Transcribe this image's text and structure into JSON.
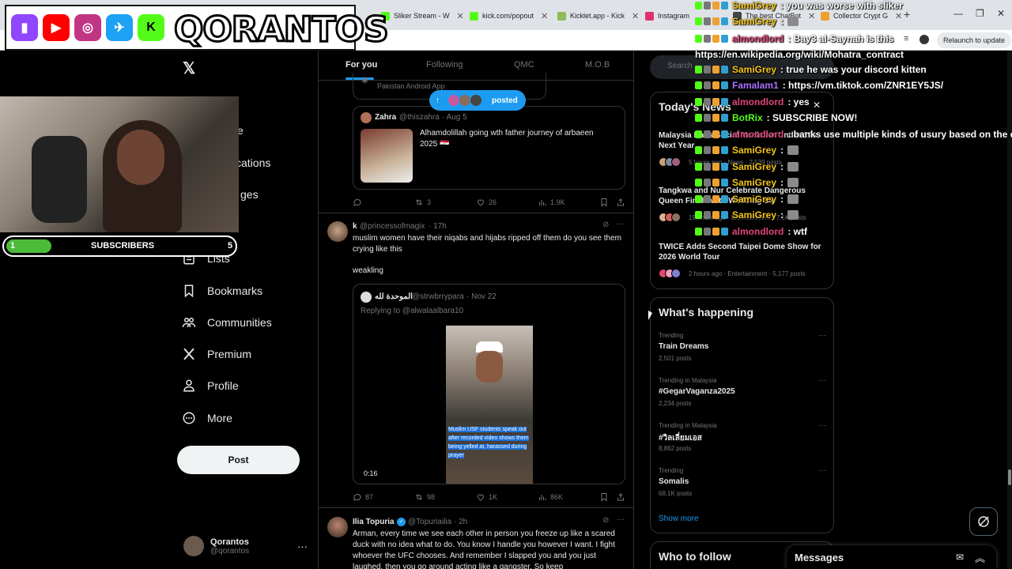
{
  "browser": {
    "tabs": [
      {
        "label": "Sliker Stream - W",
        "color": "#53fc18"
      },
      {
        "label": "kick.com/popout",
        "color": "#53fc18"
      },
      {
        "label": "Kicklet.app - Kick",
        "color": "#8fbc5a"
      },
      {
        "label": "Instagram",
        "color": "#e1306c"
      },
      {
        "label": "The best ChatBot",
        "color": "#444444"
      },
      {
        "label": "Collector Crypt G",
        "color": "#f0a030"
      }
    ],
    "new_tab": "+",
    "relaunch": "Relaunch to update"
  },
  "overlay": {
    "brand_name": "QORANTOS",
    "brand_icons": [
      {
        "name": "twitch-icon",
        "color": "#9146ff",
        "glyph": "▮"
      },
      {
        "name": "youtube-icon",
        "color": "#ff0000",
        "glyph": "▶"
      },
      {
        "name": "instagram-icon",
        "color": "#c13584",
        "glyph": "◎"
      },
      {
        "name": "twitter-bird-icon",
        "color": "#1da1f2",
        "glyph": "✈"
      },
      {
        "name": "kick-icon",
        "color": "#53fc18",
        "glyph": "K"
      }
    ],
    "subscribers": {
      "label": "SUBSCRIBERS",
      "current": "1",
      "goal": "5",
      "progress": 0.2
    }
  },
  "chat": [
    {
      "user": "SamiGrey",
      "color": "#f5c518",
      "message": ": you was worse with sliker",
      "emote": false
    },
    {
      "user": "SamiGrey",
      "color": "#f5c518",
      "message": ":",
      "emote": true
    },
    {
      "user": "almondlord",
      "color": "#e0457b",
      "message": ": Bay3 al-Saynah is this",
      "emote": false
    },
    {
      "user": "",
      "color": "#ffffff",
      "message": "https://en.wikipedia.org/wiki/Mohatra_contract",
      "emote": false
    },
    {
      "user": "SamiGrey",
      "color": "#f5c518",
      "message": ": true he was your discord kitten",
      "emote": false
    },
    {
      "user": "Famalam1",
      "color": "#a970ff",
      "message": ": https://vm.tiktok.com/ZNR1EY5JS/",
      "emote": false
    },
    {
      "user": "almondlord",
      "color": "#e0457b",
      "message": ": yes",
      "emote": false
    },
    {
      "user": "BotRix",
      "color": "#53fc18",
      "message": ": SUBSCRIBE NOW!",
      "emote": false
    },
    {
      "user": "almondlord",
      "color": "#e0457b",
      "message": ": banks use multiple kinds of usury based on the deal",
      "emote": false
    },
    {
      "user": "SamiGrey",
      "color": "#f5c518",
      "message": ":",
      "emote": true
    },
    {
      "user": "SamiGrey",
      "color": "#f5c518",
      "message": ":",
      "emote": true
    },
    {
      "user": "SamiGrey",
      "color": "#f5c518",
      "message": ":",
      "emote": true
    },
    {
      "user": "SamiGrey",
      "color": "#f5c518",
      "message": ":",
      "emote": true
    },
    {
      "user": "SamiGrey",
      "color": "#f5c518",
      "message": ":",
      "emote": true
    },
    {
      "user": "almondlord",
      "color": "#e0457b",
      "message": ": wtf",
      "emote": false
    }
  ],
  "nav": {
    "items": [
      {
        "label": "Lists",
        "icon": "list-icon"
      },
      {
        "label": "Bookmarks",
        "icon": "bookmark-icon"
      },
      {
        "label": "Communities",
        "icon": "communities-icon"
      },
      {
        "label": "Premium",
        "icon": "x-premium-icon"
      },
      {
        "label": "Profile",
        "icon": "profile-icon"
      },
      {
        "label": "More",
        "icon": "more-circle-icon"
      }
    ],
    "partial": [
      "e",
      "cations",
      "ges"
    ],
    "post_button": "Post",
    "account": {
      "name": "Qorantos",
      "handle": "@qorantos"
    }
  },
  "feed": {
    "tabs": [
      "For you",
      "Following",
      "QMC",
      "M.O.B"
    ],
    "posted_pill": "posted",
    "first_card_caption": "Pakistan Android App",
    "quote1": {
      "name": "Zahra",
      "handle": "@thiszahra",
      "date": "· Aug 5",
      "text": "Alhamdolillah going wth father journey of arbaeen 2025 🇮🇶"
    },
    "post1_stats": {
      "replies": "",
      "reposts": "3",
      "likes": "26",
      "views": "1.9K"
    },
    "post2": {
      "name": "k",
      "handle": "@princessofmagix",
      "time": "· 17h",
      "text": "muslim women have their niqabs and hijabs ripped off them do you see them crying like this",
      "text2": "weakling"
    },
    "quote2": {
      "name": "الموحدة لله",
      "handle": "@strwbrrypara",
      "date": "· Nov 22",
      "reply_to": "Replying to @alwalaalbara10",
      "video_caption": "Muslim USF students speak out after recorded video shows them being yelled at, harassed during prayer",
      "duration": "0:16"
    },
    "post2_stats": {
      "replies": "87",
      "reposts": "98",
      "likes": "1K",
      "views": "86K"
    },
    "post3": {
      "name": "Ilia Topuria",
      "handle": "@Topuriailia",
      "time": "· 2h",
      "text": "Arman, every time we see each other in person you freeze up like a scared duck with no idea what to do. You know I handle you however I want. I fight whoever the UFC chooses. And remember I slapped you and you just laughed, then you go around acting like a gangster. So keep"
    }
  },
  "sidebar": {
    "search_placeholder": "Search",
    "news_title": "Today's News",
    "news": [
      {
        "headline": "Malaysia Bans Social Media for Under-16s Next Year",
        "meta": "5 hours ago · News · 2,539 posts"
      },
      {
        "headline": "Tangkwa and Nur Celebrate Dangerous Queen Finale with Wedding Sk",
        "meta": "19 hours ago · Entertainment · 7.1K posts"
      },
      {
        "headline": "TWICE Adds Second Taipei Dome Show for 2026 World Tour",
        "meta": "2 hours ago · Entertainment · 5,177 posts"
      }
    ],
    "happening_title": "What's happening",
    "trends": [
      {
        "category": "Trending",
        "name": "Train Dreams",
        "count": "2,501 posts"
      },
      {
        "category": "Trending in Malaysia",
        "name": "#GegarVaganza2025",
        "count": "2,234 posts"
      },
      {
        "category": "Trending in Malaysia",
        "name": "#วิลเลี่ยมเอส",
        "count": "8,862 posts"
      },
      {
        "category": "Trending",
        "name": "Somalis",
        "count": "68.1K posts"
      }
    ],
    "show_more": "Show more",
    "who_to_follow": "Who to follow"
  },
  "messages": {
    "title": "Messages"
  },
  "colors": {
    "accent": "#1d9bf0",
    "bg": "#000000",
    "border": "#2f3336",
    "muted": "#71767b"
  }
}
